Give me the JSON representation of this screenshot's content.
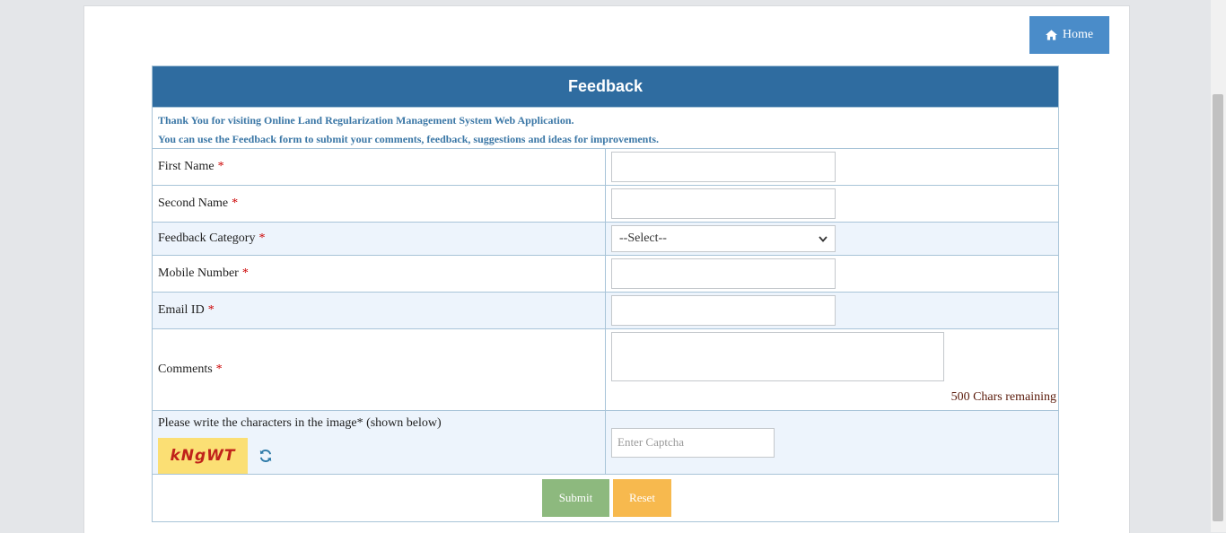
{
  "nav": {
    "home_label": "Home"
  },
  "form": {
    "title": "Feedback",
    "intro_line1": "Thank You for visiting Online Land Regularization Management System Web Application.",
    "intro_line2": "You can use the Feedback form to submit your comments, feedback, suggestions and ideas for improvements.",
    "required_marker": "*",
    "fields": {
      "first_name": {
        "label": "First Name",
        "value": ""
      },
      "second_name": {
        "label": "Second Name",
        "value": ""
      },
      "category": {
        "label": "Feedback Category",
        "selected": "--Select--"
      },
      "mobile": {
        "label": "Mobile Number",
        "value": ""
      },
      "email": {
        "label": "Email ID",
        "value": ""
      },
      "comments": {
        "label": "Comments",
        "value": "",
        "chars_remaining": "500 Chars remaining"
      }
    },
    "captcha": {
      "label": "Please write the characters in the image* (shown below)",
      "image_text": "kNgWT",
      "placeholder": "Enter Captcha"
    },
    "buttons": {
      "submit": "Submit",
      "reset": "Reset"
    }
  },
  "colors": {
    "header": "#2f6ca0",
    "home_button": "#4a8cc9",
    "submit": "#8db97e",
    "reset": "#f7b94e",
    "captcha_bg": "#fbdf74",
    "required": "#cc0000"
  },
  "icons": {
    "home": "home-icon",
    "refresh": "refresh-icon",
    "dropdown": "chevron-down-icon"
  }
}
